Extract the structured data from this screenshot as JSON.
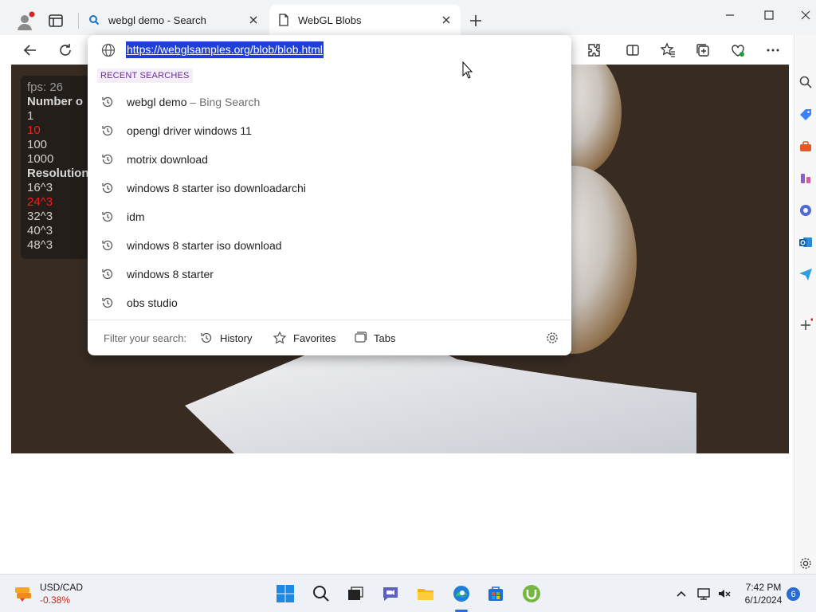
{
  "tabs": [
    {
      "title": "webgl demo - Search",
      "icon": "search-icon",
      "active": false
    },
    {
      "title": "WebGL Blobs",
      "icon": "page-icon",
      "active": true
    }
  ],
  "omnibox": {
    "url": "https://webglsamples.org/blob/blob.html",
    "section_label": "RECENT SEARCHES",
    "suggestions": [
      {
        "text": "webgl demo",
        "suffix": " – Bing Search"
      },
      {
        "text": "opengl driver windows 11",
        "suffix": ""
      },
      {
        "text": "motrix download",
        "suffix": ""
      },
      {
        "text": "windows 8 starter iso downloadarchi",
        "suffix": ""
      },
      {
        "text": "idm",
        "suffix": ""
      },
      {
        "text": "windows 8 starter iso download",
        "suffix": ""
      },
      {
        "text": "windows 8 starter",
        "suffix": ""
      },
      {
        "text": "obs studio",
        "suffix": ""
      }
    ],
    "filter_label": "Filter your search:",
    "filters": [
      "History",
      "Favorites",
      "Tabs"
    ]
  },
  "stats": {
    "fps": "fps: 26",
    "number_header": "Number o",
    "numbers": [
      {
        "label": "1",
        "selected": false
      },
      {
        "label": "10",
        "selected": true
      },
      {
        "label": "100",
        "selected": false
      },
      {
        "label": "1000",
        "selected": false
      }
    ],
    "resolution_header": "Resolution",
    "resolutions": [
      {
        "label": "16^3",
        "selected": false
      },
      {
        "label": "24^3",
        "selected": true
      },
      {
        "label": "32^3",
        "selected": false
      },
      {
        "label": "40^3",
        "selected": false
      },
      {
        "label": "48^3",
        "selected": false
      }
    ]
  },
  "taskbar": {
    "widget_title": "USD/CAD",
    "widget_value": "-0.38%",
    "time": "7:42 PM",
    "date": "6/1/2024",
    "notifications": "6"
  },
  "colors": {
    "page_bg": "#372b22",
    "url_highlight": "#1f3fd8",
    "section_accent": "#6b2a9b",
    "stat_selected": "#ff1a1a"
  }
}
